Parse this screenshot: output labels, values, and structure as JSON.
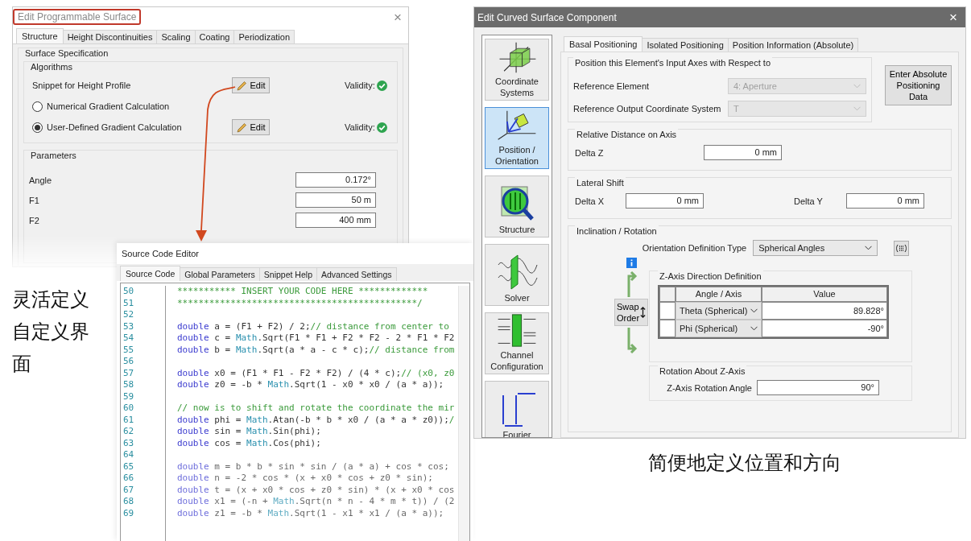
{
  "left_window": {
    "title": "Edit Programmable Surface",
    "title_highlighted": true,
    "close": "×",
    "tabs": [
      {
        "label": "Structure",
        "selected": true
      },
      {
        "label": "Height Discontinuities",
        "selected": false
      },
      {
        "label": "Scaling",
        "selected": false
      },
      {
        "label": "Coating",
        "selected": false
      },
      {
        "label": "Periodization",
        "selected": false
      }
    ],
    "surface_specification": {
      "title": "Surface Specification",
      "algorithms": {
        "title": "Algorithms",
        "rows": [
          {
            "kind": "snippet",
            "label": "Snippet for Height Profile",
            "button": "Edit",
            "validity": "Validity:",
            "valid": true
          },
          {
            "kind": "radio",
            "label": "Numerical Gradient Calculation",
            "selected": false
          },
          {
            "kind": "radio",
            "label": "User-Defined Gradient Calculation",
            "selected": true,
            "button": "Edit",
            "validity": "Validity:",
            "valid": true
          }
        ]
      },
      "parameters": {
        "title": "Parameters",
        "rows": [
          {
            "label": "Angle",
            "value": "0.172°"
          },
          {
            "label": "F1",
            "value": "50 m"
          },
          {
            "label": "F2",
            "value": "400 mm"
          }
        ]
      }
    }
  },
  "source_editor": {
    "title": "Source Code Editor",
    "tabs": [
      {
        "label": "Source Code",
        "selected": true
      },
      {
        "label": "Global Parameters",
        "selected": false
      },
      {
        "label": "Snippet Help",
        "selected": false
      },
      {
        "label": "Advanced Settings",
        "selected": false
      }
    ],
    "lines": [
      {
        "number": "50",
        "segments": [
          {
            "kind": "comment",
            "text": "*********** INSERT YOUR CODE HERE *************"
          }
        ]
      },
      {
        "number": "51",
        "segments": [
          {
            "kind": "comment",
            "text": "*********************************************/"
          }
        ]
      },
      {
        "number": "52"
      },
      {
        "number": "53",
        "segments": [
          {
            "kind": "keyword",
            "text": "double"
          },
          {
            "kind": "plain",
            "text": " a = (F1 + F2) / 2;"
          },
          {
            "kind": "comment",
            "text": "// distance from center to"
          }
        ]
      },
      {
        "number": "54",
        "segments": [
          {
            "kind": "keyword",
            "text": "double"
          },
          {
            "kind": "plain",
            "text": " c = "
          },
          {
            "kind": "type",
            "text": "Math"
          },
          {
            "kind": "plain",
            "text": ".Sqrt(F1 * F1 + F2 * F2 - 2 * F1 * F2"
          }
        ]
      },
      {
        "number": "55",
        "segments": [
          {
            "kind": "keyword",
            "text": "double"
          },
          {
            "kind": "plain",
            "text": " b = "
          },
          {
            "kind": "type",
            "text": "Math"
          },
          {
            "kind": "plain",
            "text": ".Sqrt(a * a - c * c);"
          },
          {
            "kind": "comment",
            "text": "// distance from"
          }
        ]
      },
      {
        "number": "56"
      },
      {
        "number": "57",
        "segments": [
          {
            "kind": "keyword",
            "text": "double"
          },
          {
            "kind": "plain",
            "text": " x0 = (F1 * F1 - F2 * F2) / (4 * c);"
          },
          {
            "kind": "comment",
            "text": "// (x0, z0"
          }
        ]
      },
      {
        "number": "58",
        "segments": [
          {
            "kind": "keyword",
            "text": "double"
          },
          {
            "kind": "plain",
            "text": " z0 = -b * "
          },
          {
            "kind": "type",
            "text": "Math"
          },
          {
            "kind": "plain",
            "text": ".Sqrt(1 - x0 * x0 / (a * a));"
          }
        ]
      },
      {
        "number": "59"
      },
      {
        "number": "60",
        "segments": [
          {
            "kind": "comment",
            "text": "// now is to shift and rotate the coordinate the mir"
          }
        ]
      },
      {
        "number": "61",
        "segments": [
          {
            "kind": "keyword",
            "text": "double"
          },
          {
            "kind": "plain",
            "text": " phi = "
          },
          {
            "kind": "type",
            "text": "Math"
          },
          {
            "kind": "plain",
            "text": ".Atan(-b * b * x0 / (a * a * z0));"
          },
          {
            "kind": "comment",
            "text": "/"
          }
        ]
      },
      {
        "number": "62",
        "segments": [
          {
            "kind": "keyword",
            "text": "double"
          },
          {
            "kind": "plain",
            "text": " sin = "
          },
          {
            "kind": "type",
            "text": "Math"
          },
          {
            "kind": "plain",
            "text": ".Sin(phi);"
          }
        ]
      },
      {
        "number": "63",
        "segments": [
          {
            "kind": "keyword",
            "text": "double"
          },
          {
            "kind": "plain",
            "text": " cos = "
          },
          {
            "kind": "type",
            "text": "Math"
          },
          {
            "kind": "plain",
            "text": ".Cos(phi);"
          }
        ]
      },
      {
        "number": "64"
      },
      {
        "number": "65",
        "segments": [
          {
            "kind": "keyword",
            "text": "double"
          },
          {
            "kind": "plain",
            "text": " m = b * b * sin * sin / (a * a) + cos * cos;"
          }
        ]
      },
      {
        "number": "66",
        "segments": [
          {
            "kind": "keyword",
            "text": "double"
          },
          {
            "kind": "plain",
            "text": " n = -2 * cos * (x + x0 * cos + z0 * sin);"
          }
        ]
      },
      {
        "number": "67",
        "segments": [
          {
            "kind": "keyword",
            "text": "double"
          },
          {
            "kind": "plain",
            "text": " t = (x + x0 * cos + z0 * sin) * (x + x0 * cos"
          }
        ]
      },
      {
        "number": "68",
        "segments": [
          {
            "kind": "keyword",
            "text": "double"
          },
          {
            "kind": "plain",
            "text": " x1 = (-n + "
          },
          {
            "kind": "type",
            "text": "Math"
          },
          {
            "kind": "plain",
            "text": ".Sqrt(n * n - 4 * m * t)) / (2"
          }
        ]
      },
      {
        "number": "69",
        "segments": [
          {
            "kind": "keyword",
            "text": "double"
          },
          {
            "kind": "plain",
            "text": " z1 = -b * "
          },
          {
            "kind": "type",
            "text": "Math"
          },
          {
            "kind": "plain",
            "text": ".Sqrt(1 - x1 * x1 / (a * a));"
          }
        ]
      }
    ]
  },
  "right_window": {
    "title": "Edit Curved Surface Component",
    "close": "×",
    "sidebar": [
      {
        "kind": "coordinates",
        "label": "Coordinate Systems",
        "selected": false
      },
      {
        "kind": "orientation",
        "label": "Position / Orientation",
        "selected": true
      },
      {
        "kind": "structure",
        "label": "Structure",
        "selected": false
      },
      {
        "kind": "solver",
        "label": "Solver",
        "selected": false
      },
      {
        "kind": "channel",
        "label": "Channel Configuration",
        "selected": false
      },
      {
        "kind": "fourier",
        "label": "Fourier",
        "selected": false
      }
    ],
    "tabs": [
      {
        "label": "Basal Positioning",
        "selected": true
      },
      {
        "label": "Isolated Positioning",
        "selected": false
      },
      {
        "label": "Position Information (Absolute)",
        "selected": false
      }
    ],
    "reference": {
      "title": "Position this Element's Input Axes with Respect to",
      "rows": [
        {
          "label": "Reference Element",
          "value": "4: Aperture",
          "disabled": true
        },
        {
          "label": "Reference Output Coordinate System",
          "value": "T",
          "disabled": true
        }
      ],
      "button": "Enter Absolute Positioning Data"
    },
    "relative_distance": {
      "title": "Relative Distance on Axis",
      "fields": [
        {
          "label": "Delta Z",
          "value": "0 mm"
        }
      ]
    },
    "lateral_shift": {
      "title": "Lateral Shift",
      "fields": [
        {
          "label": "Delta X",
          "value": "0 mm"
        },
        {
          "label": "Delta Y",
          "value": "0 mm"
        }
      ]
    },
    "inclination": {
      "title": "Inclination / Rotation",
      "type_label": "Orientation Definition Type",
      "type_value": "Spherical Angles",
      "direction": {
        "title": "Z-Axis Direction Definition",
        "columns": [
          "Angle / Axis",
          "Value"
        ],
        "rows": [
          {
            "axis": "Theta (Spherical)",
            "value": "89.828°"
          },
          {
            "axis": "Phi (Spherical)",
            "value": "-90°"
          }
        ]
      },
      "swap_button": "Swap Order",
      "rotation": {
        "title": "Rotation About Z-Axis",
        "label": "Z-Axis Rotation Angle",
        "value": "90°"
      }
    }
  },
  "captions": [
    "灵活定义自定义界面",
    "简便地定义位置和方向"
  ]
}
